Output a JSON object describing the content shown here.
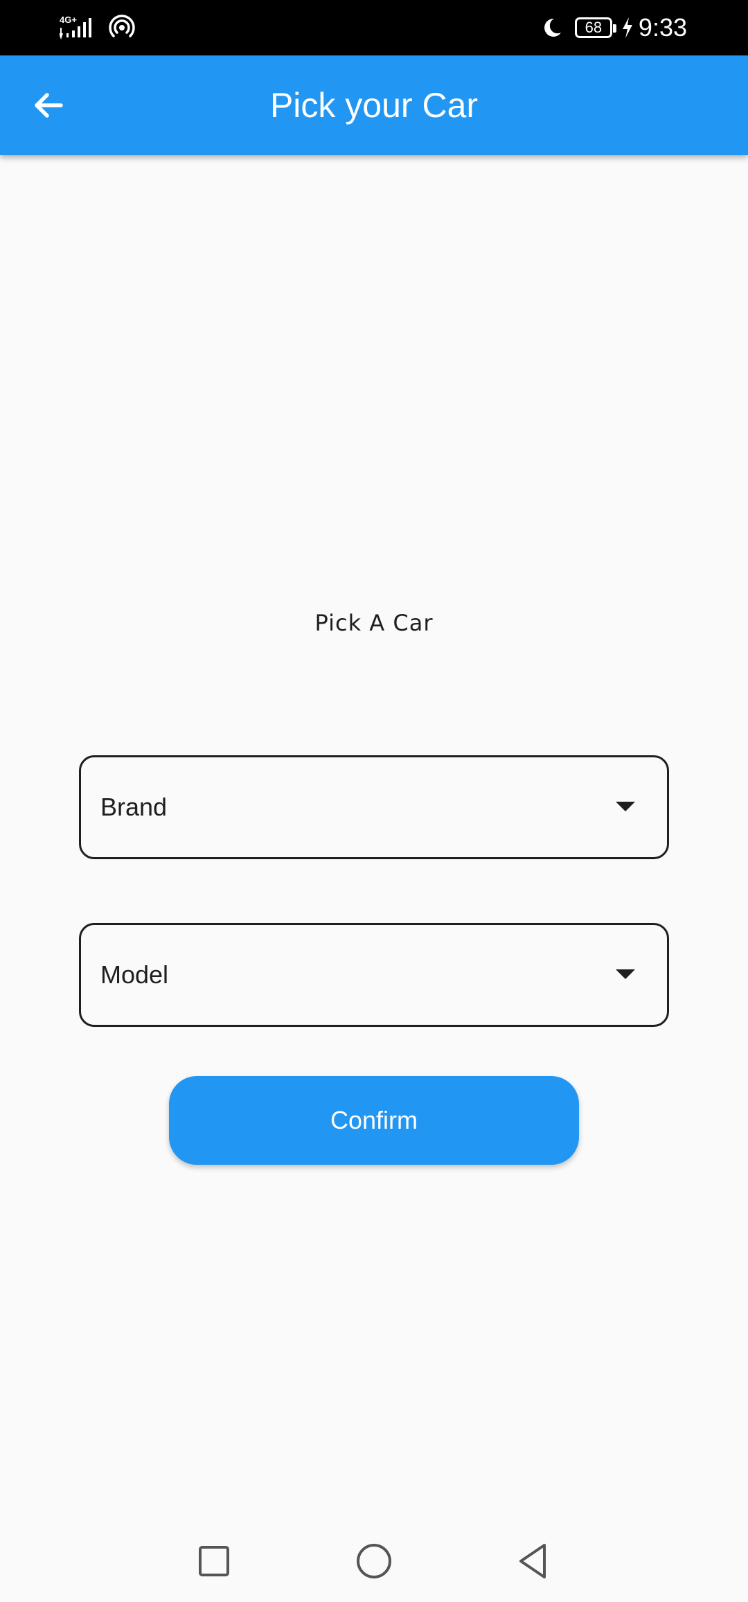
{
  "status_bar": {
    "network": "4G+",
    "battery_level": "68",
    "time": "9:33",
    "icons": [
      "signal-icon",
      "hotspot-icon",
      "moon-icon",
      "battery-icon",
      "charging-icon"
    ]
  },
  "app_bar": {
    "title": "Pick your Car",
    "back_icon": "arrow-left-icon"
  },
  "main": {
    "subtitle": "Pick A Car",
    "brand_dropdown": {
      "label": "Brand",
      "icon": "dropdown-arrow-icon"
    },
    "model_dropdown": {
      "label": "Model",
      "icon": "dropdown-arrow-icon"
    },
    "confirm_label": "Confirm"
  },
  "nav_bar": {
    "icons": [
      "recents-square-icon",
      "home-circle-icon",
      "back-triangle-icon"
    ]
  },
  "colors": {
    "primary": "#2196f3",
    "background": "#fafafa",
    "text": "#1f1f1f",
    "status_bar": "#000000"
  }
}
